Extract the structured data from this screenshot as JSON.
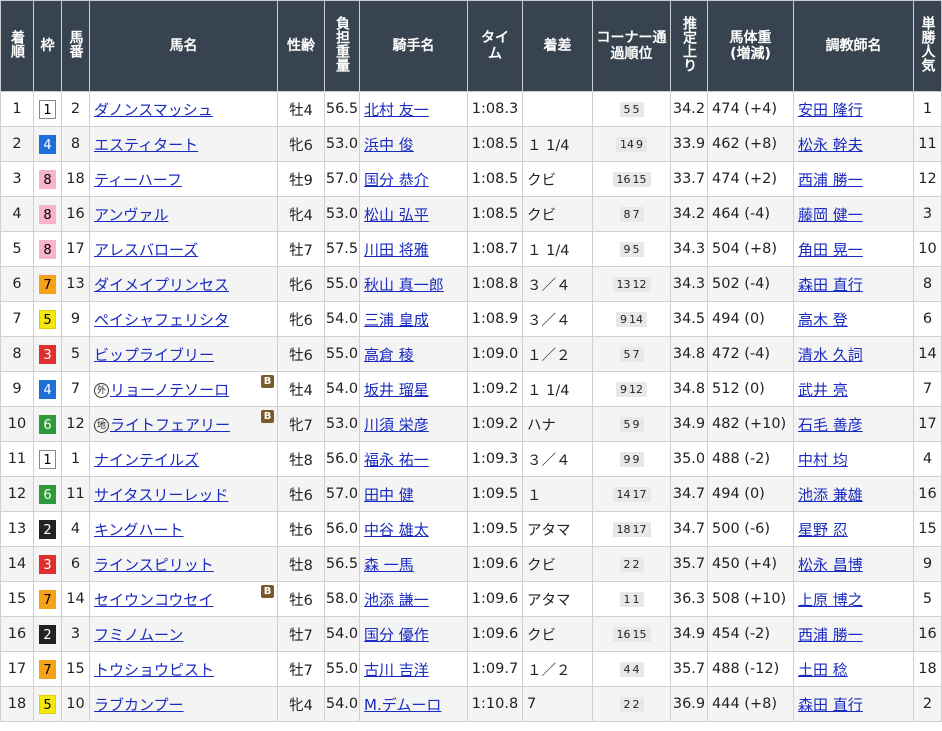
{
  "headers": [
    "着順",
    "枠",
    "馬番",
    "馬名",
    "性齢",
    "負担重量",
    "騎手名",
    "タイム",
    "着差",
    "コーナー通過順位",
    "推定上り",
    "馬体重(増減)",
    "調教師名",
    "単勝人気"
  ],
  "waku_colors": {
    "1": {
      "bg": "#ffffff",
      "fg": "#000000",
      "border": "#888888"
    },
    "2": {
      "bg": "#222222",
      "fg": "#ffffff",
      "border": "#222222"
    },
    "3": {
      "bg": "#e0302e",
      "fg": "#ffffff",
      "border": "#e0302e"
    },
    "4": {
      "bg": "#1e6fd9",
      "fg": "#ffffff",
      "border": "#1e6fd9"
    },
    "5": {
      "bg": "#f5e60f",
      "fg": "#000000",
      "border": "#e0d000"
    },
    "6": {
      "bg": "#2e9a3a",
      "fg": "#ffffff",
      "border": "#2e9a3a"
    },
    "7": {
      "bg": "#f5a21a",
      "fg": "#000000",
      "border": "#f5a21a"
    },
    "8": {
      "bg": "#f7b3c8",
      "fg": "#000000",
      "border": "#f7b3c8"
    }
  },
  "rows": [
    {
      "rank": "1",
      "waku": "1",
      "num": "2",
      "horse": "ダノンスマッシュ",
      "mark": "",
      "blinker": false,
      "sexage": "牡4",
      "weight": "56.5",
      "jockey": "北村 友一",
      "time": "1:08.3",
      "margin": "",
      "corner": [
        "5",
        "5"
      ],
      "agari": "34.2",
      "bodyweight": "474 (+4)",
      "trainer": "安田 隆行",
      "pop": "1"
    },
    {
      "rank": "2",
      "waku": "4",
      "num": "8",
      "horse": "エスティタート",
      "mark": "",
      "blinker": false,
      "sexage": "牝6",
      "weight": "53.0",
      "jockey": "浜中 俊",
      "time": "1:08.5",
      "margin": "１ 1/4",
      "corner": [
        "14",
        "9"
      ],
      "agari": "33.9",
      "bodyweight": "462 (+8)",
      "trainer": "松永 幹夫",
      "pop": "11"
    },
    {
      "rank": "3",
      "waku": "8",
      "num": "18",
      "horse": "ティーハーフ",
      "mark": "",
      "blinker": false,
      "sexage": "牡9",
      "weight": "57.0",
      "jockey": "国分 恭介",
      "time": "1:08.5",
      "margin": "クビ",
      "corner": [
        "16",
        "15"
      ],
      "agari": "33.7",
      "bodyweight": "474 (+2)",
      "trainer": "西浦 勝一",
      "pop": "12"
    },
    {
      "rank": "4",
      "waku": "8",
      "num": "16",
      "horse": "アンヴァル",
      "mark": "",
      "blinker": false,
      "sexage": "牝4",
      "weight": "53.0",
      "jockey": "松山 弘平",
      "time": "1:08.5",
      "margin": "クビ",
      "corner": [
        "8",
        "7"
      ],
      "agari": "34.2",
      "bodyweight": "464 (-4)",
      "trainer": "藤岡 健一",
      "pop": "3"
    },
    {
      "rank": "5",
      "waku": "8",
      "num": "17",
      "horse": "アレスバローズ",
      "mark": "",
      "blinker": false,
      "sexage": "牡7",
      "weight": "57.5",
      "jockey": "川田 将雅",
      "time": "1:08.7",
      "margin": "１ 1/4",
      "corner": [
        "9",
        "5"
      ],
      "agari": "34.3",
      "bodyweight": "504 (+8)",
      "trainer": "角田 晃一",
      "pop": "10"
    },
    {
      "rank": "6",
      "waku": "7",
      "num": "13",
      "horse": "ダイメイプリンセス",
      "mark": "",
      "blinker": false,
      "sexage": "牝6",
      "weight": "55.0",
      "jockey": "秋山 真一郎",
      "time": "1:08.8",
      "margin": "３／４",
      "corner": [
        "13",
        "12"
      ],
      "agari": "34.3",
      "bodyweight": "502 (-4)",
      "trainer": "森田 直行",
      "pop": "8"
    },
    {
      "rank": "7",
      "waku": "5",
      "num": "9",
      "horse": "ペイシャフェリシタ",
      "mark": "",
      "blinker": false,
      "sexage": "牝6",
      "weight": "54.0",
      "jockey": "三浦 皇成",
      "time": "1:08.9",
      "margin": "３／４",
      "corner": [
        "9",
        "14"
      ],
      "agari": "34.5",
      "bodyweight": "494 (0)",
      "trainer": "高木 登",
      "pop": "6"
    },
    {
      "rank": "8",
      "waku": "3",
      "num": "5",
      "horse": "ビップライブリー",
      "mark": "",
      "blinker": false,
      "sexage": "牡6",
      "weight": "55.0",
      "jockey": "高倉 稜",
      "time": "1:09.0",
      "margin": "１／２",
      "corner": [
        "5",
        "7"
      ],
      "agari": "34.8",
      "bodyweight": "472 (-4)",
      "trainer": "清水 久詞",
      "pop": "14"
    },
    {
      "rank": "9",
      "waku": "4",
      "num": "7",
      "horse": "リョーノテソーロ",
      "mark": "外",
      "blinker": true,
      "sexage": "牡4",
      "weight": "54.0",
      "jockey": "坂井 瑠星",
      "time": "1:09.2",
      "margin": "１ 1/4",
      "corner": [
        "9",
        "12"
      ],
      "agari": "34.8",
      "bodyweight": "512 (0)",
      "trainer": "武井 亮",
      "pop": "7"
    },
    {
      "rank": "10",
      "waku": "6",
      "num": "12",
      "horse": "ライトフェアリー",
      "mark": "地",
      "blinker": true,
      "sexage": "牝7",
      "weight": "53.0",
      "jockey": "川須 栄彦",
      "time": "1:09.2",
      "margin": "ハナ",
      "corner": [
        "5",
        "9"
      ],
      "agari": "34.9",
      "bodyweight": "482 (+10)",
      "trainer": "石毛 善彦",
      "pop": "17"
    },
    {
      "rank": "11",
      "waku": "1",
      "num": "1",
      "horse": "ナインテイルズ",
      "mark": "",
      "blinker": false,
      "sexage": "牡8",
      "weight": "56.0",
      "jockey": "福永 祐一",
      "time": "1:09.3",
      "margin": "３／４",
      "corner": [
        "9",
        "9"
      ],
      "agari": "35.0",
      "bodyweight": "488 (-2)",
      "trainer": "中村 均",
      "pop": "4"
    },
    {
      "rank": "12",
      "waku": "6",
      "num": "11",
      "horse": "サイタスリーレッド",
      "mark": "",
      "blinker": false,
      "sexage": "牡6",
      "weight": "57.0",
      "jockey": "田中 健",
      "time": "1:09.5",
      "margin": "１",
      "corner": [
        "14",
        "17"
      ],
      "agari": "34.7",
      "bodyweight": "494 (0)",
      "trainer": "池添 兼雄",
      "pop": "16"
    },
    {
      "rank": "13",
      "waku": "2",
      "num": "4",
      "horse": "キングハート",
      "mark": "",
      "blinker": false,
      "sexage": "牡6",
      "weight": "56.0",
      "jockey": "中谷 雄太",
      "time": "1:09.5",
      "margin": "アタマ",
      "corner": [
        "18",
        "17"
      ],
      "agari": "34.7",
      "bodyweight": "500 (-6)",
      "trainer": "星野 忍",
      "pop": "15"
    },
    {
      "rank": "14",
      "waku": "3",
      "num": "6",
      "horse": "ラインスピリット",
      "mark": "",
      "blinker": false,
      "sexage": "牡8",
      "weight": "56.5",
      "jockey": "森 一馬",
      "time": "1:09.6",
      "margin": "クビ",
      "corner": [
        "2",
        "2"
      ],
      "agari": "35.7",
      "bodyweight": "450 (+4)",
      "trainer": "松永 昌博",
      "pop": "9"
    },
    {
      "rank": "15",
      "waku": "7",
      "num": "14",
      "horse": "セイウンコウセイ",
      "mark": "",
      "blinker": true,
      "sexage": "牡6",
      "weight": "58.0",
      "jockey": "池添 謙一",
      "time": "1:09.6",
      "margin": "アタマ",
      "corner": [
        "1",
        "1"
      ],
      "agari": "36.3",
      "bodyweight": "508 (+10)",
      "trainer": "上原 博之",
      "pop": "5"
    },
    {
      "rank": "16",
      "waku": "2",
      "num": "3",
      "horse": "フミノムーン",
      "mark": "",
      "blinker": false,
      "sexage": "牡7",
      "weight": "54.0",
      "jockey": "国分 優作",
      "time": "1:09.6",
      "margin": "クビ",
      "corner": [
        "16",
        "15"
      ],
      "agari": "34.9",
      "bodyweight": "454 (-2)",
      "trainer": "西浦 勝一",
      "pop": "16"
    },
    {
      "rank": "17",
      "waku": "7",
      "num": "15",
      "horse": "トウショウピスト",
      "mark": "",
      "blinker": false,
      "sexage": "牡7",
      "weight": "55.0",
      "jockey": "古川 吉洋",
      "time": "1:09.7",
      "margin": "１／２",
      "corner": [
        "4",
        "4"
      ],
      "agari": "35.7",
      "bodyweight": "488 (-12)",
      "trainer": "土田 稔",
      "pop": "18"
    },
    {
      "rank": "18",
      "waku": "5",
      "num": "10",
      "horse": "ラブカンプー",
      "mark": "",
      "blinker": false,
      "sexage": "牝4",
      "weight": "54.0",
      "jockey": "M.デムーロ",
      "time": "1:10.8",
      "margin": "7",
      "corner": [
        "2",
        "2"
      ],
      "agari": "36.9",
      "bodyweight": "444 (+8)",
      "trainer": "森田 直行",
      "pop": "2"
    }
  ],
  "blinker_label": "B"
}
